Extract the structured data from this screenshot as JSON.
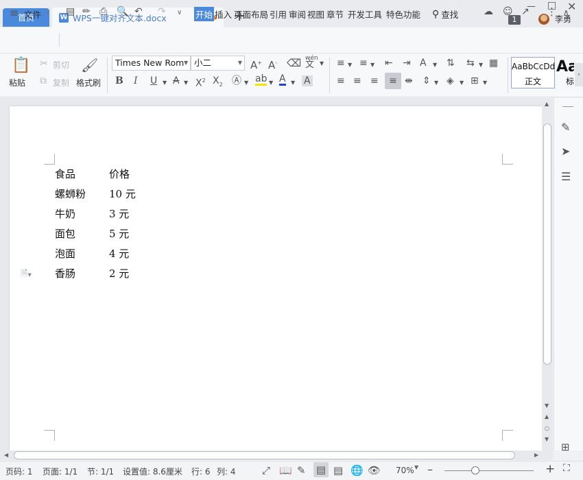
{
  "titlebar": {
    "home_tab": "首页",
    "doc_tab": "WPS一键对齐文本.docx",
    "new_tab": "+",
    "window_count": "1",
    "user_name": "李勇"
  },
  "menubar": {
    "file_menu": "文件",
    "tabs": [
      "开始",
      "插入",
      "页面布局",
      "引用",
      "审阅",
      "视图",
      "章节",
      "开发工具",
      "特色功能"
    ],
    "search": "查找"
  },
  "ribbon": {
    "paste": "粘贴",
    "cut": "剪切",
    "copy": "复制",
    "format_painter": "格式刷",
    "font_name": "Times New Roman",
    "font_size": "小二",
    "phonetic": "wén",
    "style_normal_preview": "AaBbCcDd",
    "style_normal_label": "正文",
    "style_heading_preview": "Aa",
    "style_heading_label": "标"
  },
  "document": {
    "table_rows": [
      {
        "food": "食品",
        "price": "价格"
      },
      {
        "food": "螺蛳粉",
        "price": "10 元"
      },
      {
        "food": "牛奶",
        "price": "3 元"
      },
      {
        "food": "面包",
        "price": "5 元"
      },
      {
        "food": "泡面",
        "price": "4 元"
      },
      {
        "food": "香肠",
        "price": "2 元"
      }
    ]
  },
  "statusbar": {
    "page_num": "页码: 1",
    "page_count": "页面: 1/1",
    "section": "节: 1/1",
    "setting": "设置值: 8.6厘米",
    "row": "行: 6",
    "col": "列: 4",
    "zoom": "70%"
  },
  "colors": {
    "accent": "#4a89dc",
    "modified_dot": "#f08a3c"
  }
}
